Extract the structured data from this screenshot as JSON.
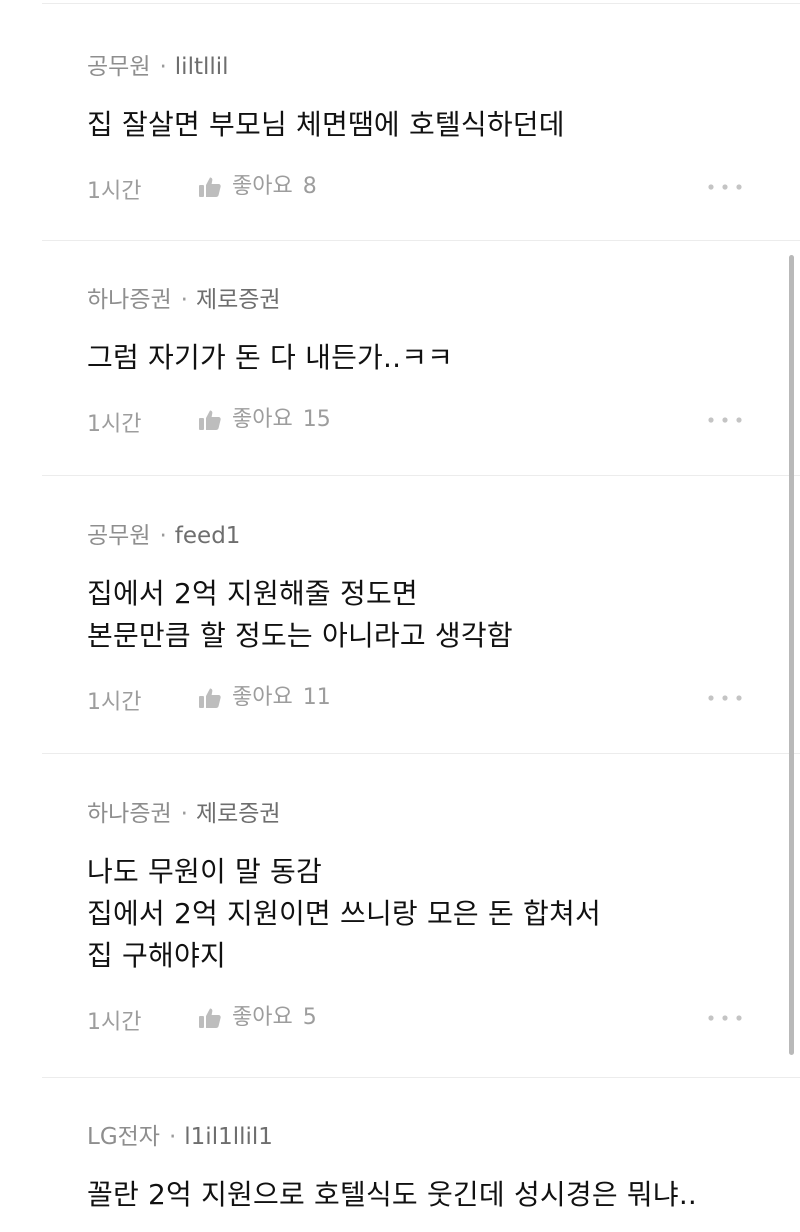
{
  "comments": [
    {
      "company": "공무원",
      "nickname": "liltllil",
      "lines": [
        "집 잘살면 부모님 체면땜에 호텔식하던데"
      ],
      "time": "1시간",
      "like_label": "좋아요",
      "like_count": "8"
    },
    {
      "company": "하나증권",
      "nickname": "제로증권",
      "lines": [
        "그럼 자기가 돈 다 내든가..ㅋㅋ"
      ],
      "time": "1시간",
      "like_label": "좋아요",
      "like_count": "15"
    },
    {
      "company": "공무원",
      "nickname": "feed1",
      "lines": [
        "집에서 2억 지원해줄 정도면",
        "본문만큼 할 정도는 아니라고 생각함"
      ],
      "time": "1시간",
      "like_label": "좋아요",
      "like_count": "11"
    },
    {
      "company": "하나증권",
      "nickname": "제로증권",
      "lines": [
        "나도 무원이 말 동감",
        "집에서 2억 지원이면 쓰니랑 모은 돈 합쳐서",
        "집 구해야지"
      ],
      "time": "1시간",
      "like_label": "좋아요",
      "like_count": "5"
    },
    {
      "company": "LG전자",
      "nickname": "l1il1llil1",
      "lines": [
        "꼴란 2억 지원으로 호텔식도 웃긴데 성시경은 뭐냐.."
      ]
    }
  ],
  "separator": "·",
  "icons": {
    "like": "thumbs-up-icon",
    "more": "more-dots-icon"
  },
  "colors": {
    "meta_gray": "#8e8e8e",
    "body_text": "#111111",
    "divider": "#ececec"
  }
}
